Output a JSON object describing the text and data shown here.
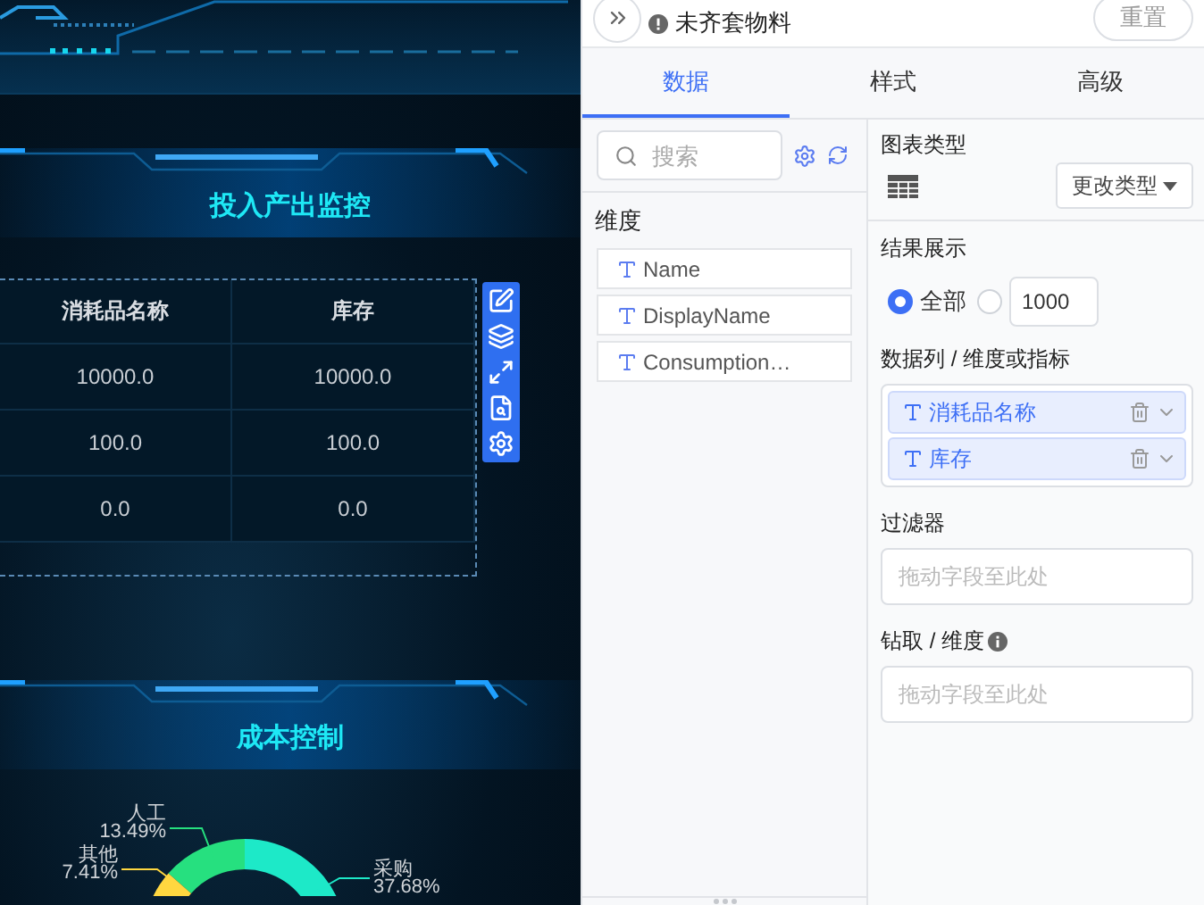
{
  "dashboard": {
    "table_panel": {
      "title": "投入产出监控",
      "table": {
        "columns": [
          "消耗品名称",
          "库存"
        ],
        "rows": [
          [
            "10000.0",
            "10000.0"
          ],
          [
            "100.0",
            "100.0"
          ],
          [
            "0.0",
            "0.0"
          ]
        ]
      }
    },
    "chart_panel": {
      "title": "成本控制",
      "chart_data": {
        "type": "donut",
        "categories": [
          "人工",
          "其他",
          "采购"
        ],
        "values": [
          13.49,
          7.41,
          37.68
        ],
        "value_labels": [
          "13.49%",
          "7.41%",
          "37.68%"
        ],
        "colors": [
          "#26e07f",
          "#ffd740",
          "#1de9c8"
        ]
      }
    }
  },
  "editor": {
    "top_bar": {
      "title": "未齐套物料",
      "reset_button": "重置"
    },
    "tabs": [
      {
        "label": "数据",
        "selected": true
      },
      {
        "label": "样式",
        "selected": false
      },
      {
        "label": "高级",
        "selected": false
      }
    ],
    "fields_pane": {
      "search": {
        "placeholder": "搜索"
      },
      "section_title": "维度",
      "fields": [
        {
          "name": "Name"
        },
        {
          "name": "DisplayName"
        },
        {
          "name": "Consumption…"
        }
      ]
    },
    "settings": {
      "chart_type": {
        "label": "图表类型",
        "change_button": "更改类型"
      },
      "result_display": {
        "label": "结果展示",
        "options": [
          {
            "kind": "all",
            "label": "全部",
            "selected": true
          },
          {
            "kind": "limit",
            "value": "1000",
            "selected": false
          }
        ]
      },
      "columns": {
        "label": "数据列 / 维度或指标",
        "items": [
          {
            "name": "消耗品名称"
          },
          {
            "name": "库存"
          }
        ]
      },
      "filter": {
        "label": "过滤器",
        "placeholder": "拖动字段至此处"
      },
      "drill": {
        "label": "钻取 / 维度",
        "placeholder": "拖动字段至此处"
      }
    }
  }
}
